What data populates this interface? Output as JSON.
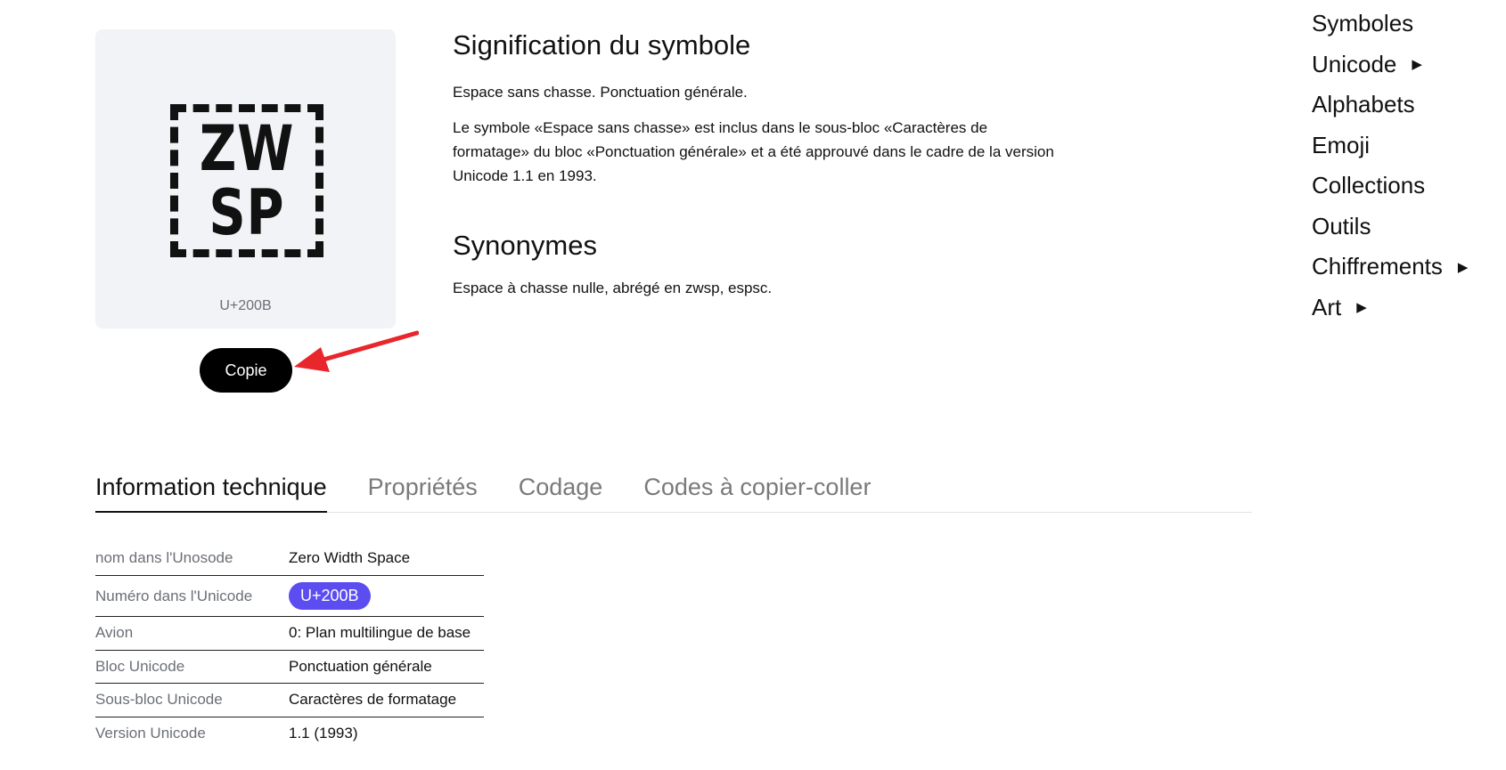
{
  "symbol": {
    "glyph_line1": "ZW",
    "glyph_line2": "SP",
    "code": "U+200B",
    "copy_label": "Copie"
  },
  "meaning": {
    "title": "Signification du symbole",
    "short": "Espace sans chasse. Ponctuation générale.",
    "long": "Le symbole «Espace sans chasse» est inclus dans le sous-bloc «Caractères de formatage» du bloc «Ponctuation générale» et a été approuvé dans le cadre de la version Unicode 1.1 en 1993."
  },
  "synonyms": {
    "title": "Synonymes",
    "text": "Espace à chasse nulle, abrégé en zwsp, espsc."
  },
  "nav": {
    "items": [
      {
        "label": "Symboles",
        "arrow": ""
      },
      {
        "label": "Unicode",
        "arrow": "▶"
      },
      {
        "label": "Alphabets",
        "arrow": ""
      },
      {
        "label": "Emoji",
        "arrow": ""
      },
      {
        "label": "Collections",
        "arrow": ""
      },
      {
        "label": "Outils",
        "arrow": ""
      },
      {
        "label": "Chiffrements",
        "arrow": "▶"
      },
      {
        "label": "Art",
        "arrow": "▶"
      }
    ]
  },
  "tabs": [
    {
      "label": "Information technique",
      "active": true
    },
    {
      "label": "Propriétés",
      "active": false
    },
    {
      "label": "Codage",
      "active": false
    },
    {
      "label": "Codes à copier-coller",
      "active": false
    }
  ],
  "info": {
    "rows": [
      {
        "label": "nom dans l'Unosode",
        "value": "Zero Width Space"
      },
      {
        "label": "Numéro dans l'Unicode",
        "value": "U+200B"
      },
      {
        "label": "Avion",
        "value": "0: Plan multilingue de base"
      },
      {
        "label": "Bloc Unicode",
        "value": "Ponctuation générale"
      },
      {
        "label": "Sous-bloc Unicode",
        "value": "Caractères de formatage"
      },
      {
        "label": "Version Unicode",
        "value": "1.1 (1993)"
      }
    ]
  },
  "colors": {
    "badge": "#5b4df0",
    "annotation_arrow": "#e8262b",
    "card_bg": "#f1f3f7"
  }
}
